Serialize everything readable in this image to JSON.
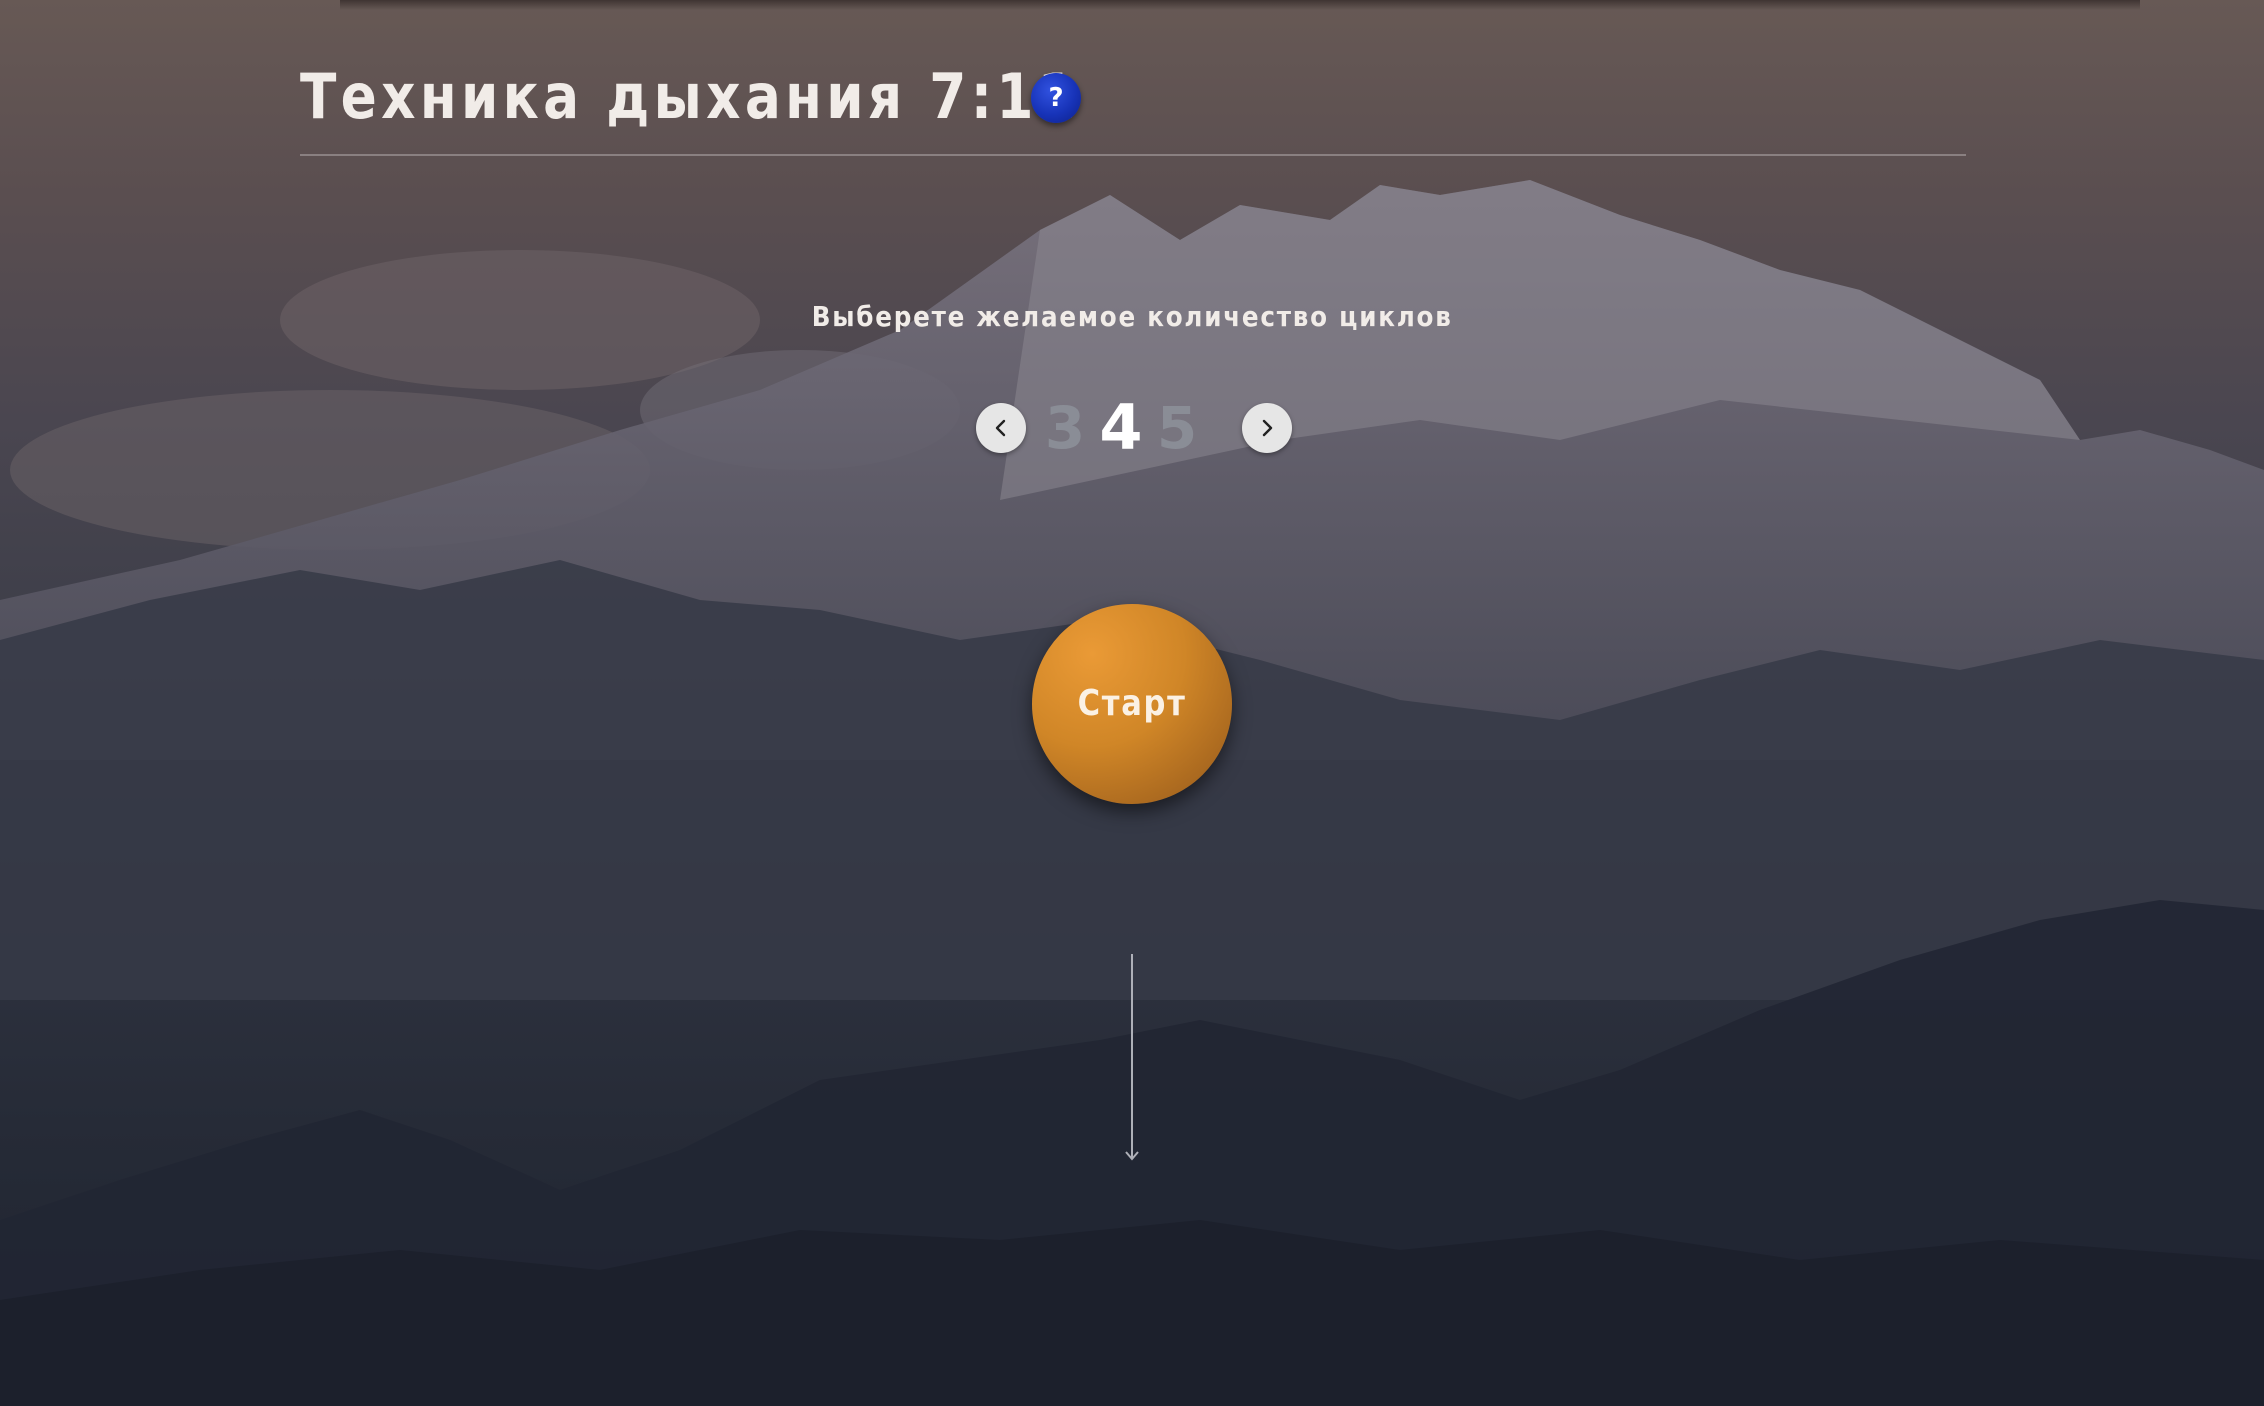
{
  "header": {
    "title": "Техника дыхания 7:11",
    "help_label": "?"
  },
  "main": {
    "prompt": "Выберете желаемое количество циклов",
    "cycles": {
      "previous": "3",
      "current": "4",
      "next": "5"
    },
    "start_label": "Старт"
  },
  "icons": {
    "help": "question-mark-icon",
    "prev": "chevron-left-icon",
    "next": "chevron-right-icon",
    "scroll": "arrow-down-icon"
  },
  "colors": {
    "accent": "#d08627",
    "help_button": "#1733b8",
    "text": "#f1ece8",
    "inactive_number": "#8a8d96"
  }
}
